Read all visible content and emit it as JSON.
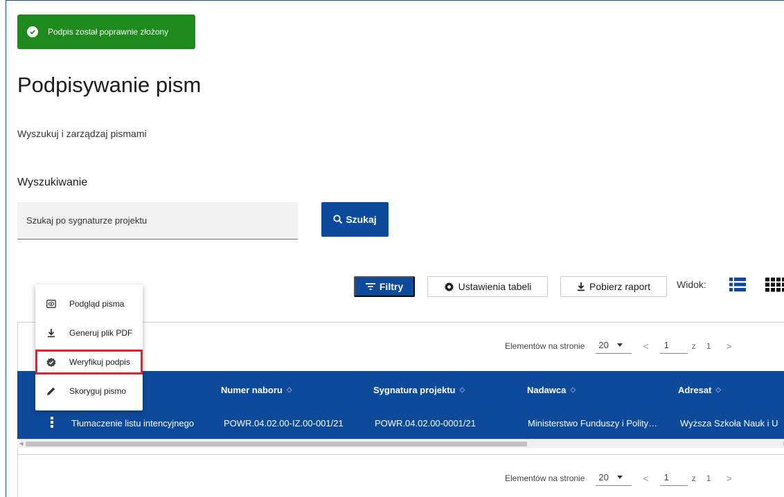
{
  "toast": {
    "message": "Podpis został poprawnie złożony",
    "color": "#1e8a1e"
  },
  "page": {
    "title": "Podpisywanie pism",
    "subtitle": "Wyszukuj i zarządzaj pismami"
  },
  "search": {
    "section_title": "Wyszukiwanie",
    "placeholder": "Szukaj po sygnaturze projektu",
    "button_label": "Szukaj"
  },
  "toolbar": {
    "filters_label": "Filtry",
    "table_settings_label": "Ustawienia tabeli",
    "download_report_label": "Pobierz raport",
    "view_label": "Widok:"
  },
  "pagination": {
    "label": "Elementów na stronie",
    "page_size": "20",
    "current_page": "1",
    "of_text": "z 1",
    "prev": "<",
    "next": ">"
  },
  "table": {
    "columns": [
      "Numer naboru",
      "Sygnatura projektu",
      "Nadawca",
      "Adresat"
    ],
    "sort_glyph": "◇",
    "rows": [
      {
        "nazwa": "Tłumaczenie listu intencyjnego",
        "numer_naboru": "POWR.04.02.00-IZ.00-001/21",
        "sygnatura": "POWR.04.02.00-0001/21",
        "nadawca": "Ministerstwo Funduszy i Polity…",
        "adresat": "Wyższa Szkoła Nauk i U"
      }
    ],
    "header_color": "#0d4a9c"
  },
  "context_menu": {
    "items": [
      {
        "label": "Podgląd pisma",
        "icon": "eye-icon"
      },
      {
        "label": "Generuj plik PDF",
        "icon": "download-icon"
      },
      {
        "label": "Weryfikuj podpis",
        "icon": "verified-badge-icon",
        "highlighted": true
      },
      {
        "label": "Skoryguj pismo",
        "icon": "pencil-icon"
      }
    ],
    "highlight_color": "#e5212c"
  },
  "colors": {
    "primary": "#0d4a9c",
    "success": "#1e8a1e"
  }
}
